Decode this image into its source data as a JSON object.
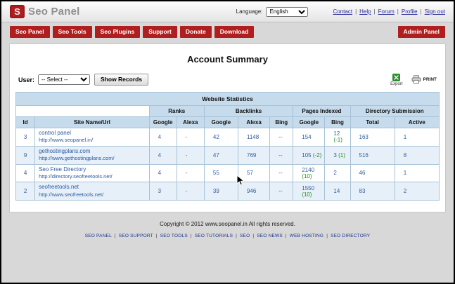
{
  "colors": {
    "accent_red": "#b01f1f",
    "table_header_blue": "#c6dbeb",
    "row_alt_blue": "#e7f0f8",
    "link_blue": "#2c5aa0",
    "diff_green": "#1e8c1e"
  },
  "header": {
    "logo_text": "S",
    "app_title": "Seo Panel",
    "language_label": "Language:",
    "language_selected": "English",
    "links": [
      "Contact",
      "Help",
      "Forum",
      "Profile",
      "Sign out"
    ],
    "separator": "|"
  },
  "nav": {
    "items": [
      "Seo Panel",
      "Seo Tools",
      "Seo Plugins",
      "Support",
      "Donate",
      "Download"
    ],
    "admin_label": "Admin Panel"
  },
  "main": {
    "title": "Account Summary",
    "user_label": "User:",
    "user_selected": "-- Select --",
    "show_records_label": "Show Records",
    "export_label": "Export",
    "print_label": "PRINT"
  },
  "table": {
    "title": "Website Statistics",
    "groups": {
      "ranks": "Ranks",
      "backlinks": "Backlinks",
      "pages_indexed": "Pages Indexed",
      "directory": "Directory Submission"
    },
    "cols": {
      "id": "Id",
      "site": "Site Name/Url",
      "google": "Google",
      "alexa": "Alexa",
      "bing": "Bing",
      "total": "Total",
      "active": "Active"
    },
    "rows": [
      {
        "id": "3",
        "name": "control panel",
        "url": "http://www.seopanel.in/",
        "rank_google": "4",
        "rank_alexa": "-",
        "backlinks_google": "42",
        "backlinks_alexa": "1148",
        "backlinks_bing": "--",
        "pages_google": "154",
        "pages_google_diff": "",
        "pages_bing": "12",
        "pages_bing_diff": "(-1)",
        "dir_total": "163",
        "dir_active": "1"
      },
      {
        "id": "9",
        "name": "gethostingplans.com",
        "url": "http://www.gethostingplans.com/",
        "rank_google": "4",
        "rank_alexa": "-",
        "backlinks_google": "47",
        "backlinks_alexa": "769",
        "backlinks_bing": "--",
        "pages_google": "105",
        "pages_google_diff": "(-2)",
        "pages_bing": "3",
        "pages_bing_diff": "(1)",
        "dir_total": "516",
        "dir_active": "8"
      },
      {
        "id": "4",
        "name": "Seo Free Directory",
        "url": "http://directory.seofreetools.net/",
        "rank_google": "4",
        "rank_alexa": "-",
        "backlinks_google": "55",
        "backlinks_alexa": "57",
        "backlinks_bing": "--",
        "pages_google": "2140",
        "pages_google_diff": "(10)",
        "pages_bing": "2",
        "pages_bing_diff": "",
        "dir_total": "46",
        "dir_active": "1"
      },
      {
        "id": "2",
        "name": "seofreetools.net",
        "url": "http://www.seofreetools.net/",
        "rank_google": "3",
        "rank_alexa": "-",
        "backlinks_google": "39",
        "backlinks_alexa": "946",
        "backlinks_bing": "--",
        "pages_google": "1550",
        "pages_google_diff": "(10)",
        "pages_bing": "14",
        "pages_bing_diff": "",
        "dir_total": "83",
        "dir_active": "2"
      }
    ]
  },
  "footer": {
    "copyright": "Copyright © 2012 www.seopanel.in All rights reserved.",
    "links": [
      "SEO PANEL",
      "SEO SUPPORT",
      "SEO TOOLS",
      "SEO TUTORIALS",
      "SEO",
      "SEO NEWS",
      "WEB HOSTING",
      "SEO DIRECTORY"
    ],
    "separator": "|"
  }
}
